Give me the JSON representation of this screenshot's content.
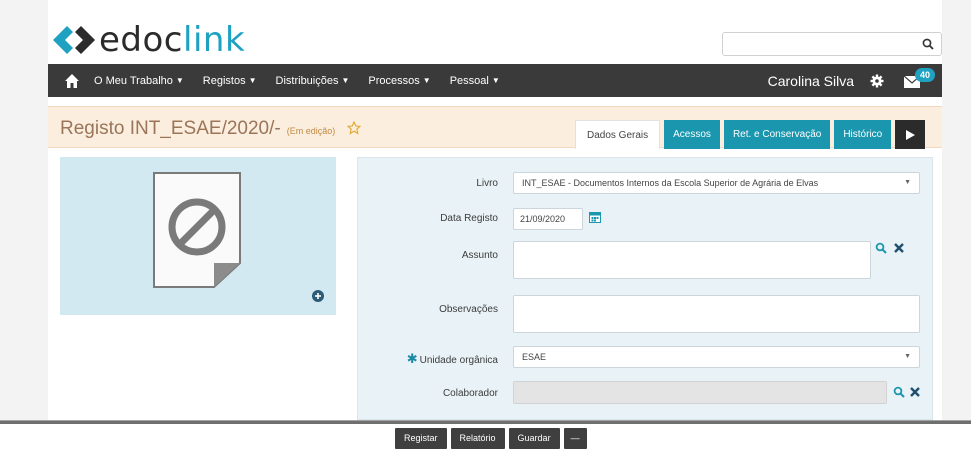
{
  "brand": {
    "name_dark": "edoc",
    "name_light": "link"
  },
  "search": {
    "placeholder": "",
    "icon": "search-icon"
  },
  "nav": {
    "home_icon": "home-icon",
    "items": [
      {
        "label": "O Meu Trabalho"
      },
      {
        "label": "Registos"
      },
      {
        "label": "Distribuições"
      },
      {
        "label": "Processos"
      },
      {
        "label": "Pessoal"
      }
    ],
    "user": "Carolina Silva",
    "settings_icon": "gear-icon",
    "mail_icon": "mail-icon",
    "mail_count": "40"
  },
  "title": {
    "text": "Registo INT_ESAE/2020/-",
    "status": "(Em edição)",
    "favorite_icon": "star-icon"
  },
  "tabs": [
    {
      "label": "Dados Gerais"
    },
    {
      "label": "Acessos"
    },
    {
      "label": "Ret. e Conservação"
    },
    {
      "label": "Histórico"
    }
  ],
  "tab_more_icon": "play-icon",
  "preview": {
    "doc_icon": "blocked-document-icon",
    "add_icon": "plus-circle-icon"
  },
  "form": {
    "livro": {
      "label": "Livro",
      "value": "INT_ESAE - Documentos Internos da Escola Superior de Agrária de Elvas"
    },
    "data_registo": {
      "label": "Data Registo",
      "value": "21/09/2020"
    },
    "assunto": {
      "label": "Assunto",
      "value": ""
    },
    "observacoes": {
      "label": "Observações",
      "value": ""
    },
    "unidade": {
      "label": "Unidade orgânica",
      "value": "ESAE",
      "required": "✱"
    },
    "colaborador": {
      "label": "Colaborador",
      "value": ""
    }
  },
  "actions": {
    "registar": "Registar",
    "relatorio": "Relatório",
    "guardar": "Guardar",
    "collapse": "—"
  },
  "colors": {
    "teal": "#1a96ae",
    "navbar": "#3a3a3a",
    "title_bg": "#fbeede",
    "panel": "#d3e9f1"
  }
}
